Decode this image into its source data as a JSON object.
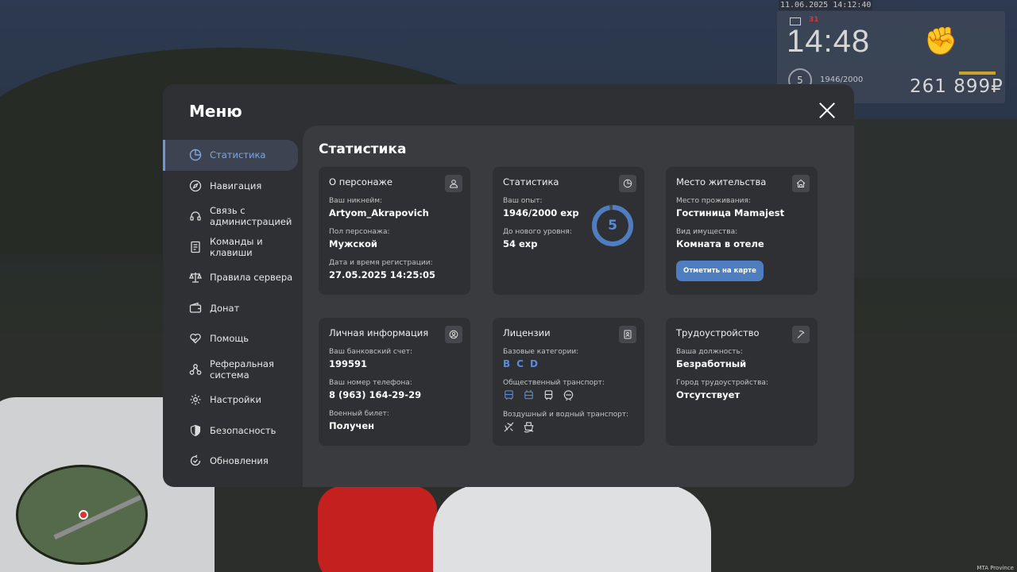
{
  "hud": {
    "datetime": "11.06.2025 14:12:40",
    "time": "14:48",
    "mail_count": "31",
    "level": "5",
    "exp": "1946/2000",
    "money": "261 899₽",
    "watermark": "MTA Province"
  },
  "menu": {
    "title": "Меню",
    "sidebar": [
      {
        "label": "Статистика",
        "icon": "pie-chart-icon",
        "active": true
      },
      {
        "label": "Навигация",
        "icon": "compass-icon"
      },
      {
        "label": "Связь с администрацией",
        "icon": "headset-icon"
      },
      {
        "label": "Команды и клавиши",
        "icon": "document-icon"
      },
      {
        "label": "Правила сервера",
        "icon": "scales-icon"
      },
      {
        "label": "Донат",
        "icon": "wallet-icon"
      },
      {
        "label": "Помощь",
        "icon": "heart-hands-icon"
      },
      {
        "label": "Реферальная система",
        "icon": "network-icon"
      },
      {
        "label": "Настройки",
        "icon": "gear-icon"
      },
      {
        "label": "Безопасность",
        "icon": "shield-icon"
      },
      {
        "label": "Обновления",
        "icon": "refresh-check-icon"
      }
    ]
  },
  "content": {
    "title": "Статистика",
    "character": {
      "title": "О персонаже",
      "nickname_label": "Ваш никнейм:",
      "nickname": "Artyom_Akrapovich",
      "gender_label": "Пол персонажа:",
      "gender": "Мужской",
      "reg_label": "Дата и время регистрации:",
      "reg": "27.05.2025 14:25:05"
    },
    "stats": {
      "title": "Статистика",
      "exp_label": "Ваш опыт:",
      "exp": "1946/2000 exp",
      "next_label": "До нового уровня:",
      "next": "54 exp",
      "level": "5",
      "progress": 0.973
    },
    "residence": {
      "title": "Место жительства",
      "place_label": "Место проживания:",
      "place": "Гостиница Mamajest",
      "type_label": "Вид имущества:",
      "type": "Комната в отеле",
      "button": "Отметить на карте"
    },
    "personal": {
      "title": "Личная информация",
      "bank_label": "Ваш банковский счет:",
      "bank": "199591",
      "phone_label": "Ваш номер телефона:",
      "phone": "8 (963) 164-29-29",
      "military_label": "Военный билет:",
      "military": "Получен"
    },
    "licenses": {
      "title": "Лицензии",
      "base_label": "Базовые категории:",
      "categories": [
        "B",
        "C",
        "D"
      ],
      "public_label": "Общественный транспорт:",
      "air_label": "Воздушный и водный транспорт:"
    },
    "employment": {
      "title": "Трудоустройство",
      "position_label": "Ваша должность:",
      "position": "Безработный",
      "city_label": "Город трудоустройства:",
      "city": "Отсутствует"
    }
  }
}
